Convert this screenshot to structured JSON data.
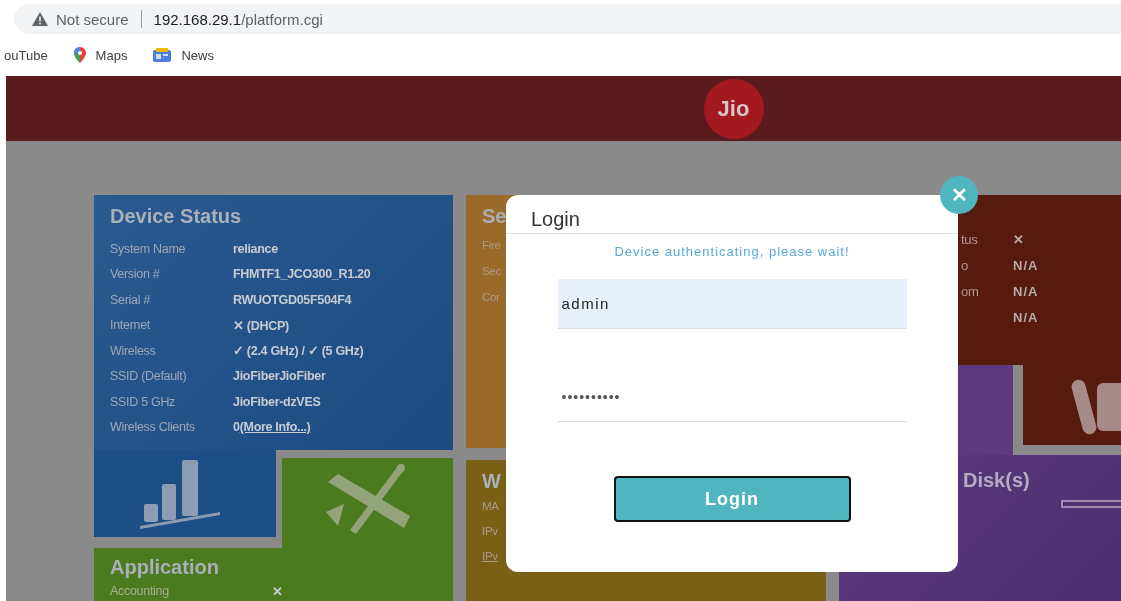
{
  "browser": {
    "security": "Not secure",
    "url_host": "192.168.29.1",
    "url_path": "/platform.cgi",
    "bookmarks": [
      {
        "label": "ouTube",
        "kind": "plain"
      },
      {
        "label": "Maps",
        "kind": "maps"
      },
      {
        "label": "News",
        "kind": "news"
      }
    ]
  },
  "header": {
    "logo": "Jio"
  },
  "device_status": {
    "title": "Device Status",
    "rows": [
      {
        "label": "System Name",
        "value": "reliance"
      },
      {
        "label": "Version #",
        "value": "FHMTF1_JCO300_R1.20"
      },
      {
        "label": "Serial #",
        "value": "RWUOTGD05F504F4"
      },
      {
        "label": "Internet",
        "value": "✕ (DHCP)"
      },
      {
        "label": "Wireless",
        "value": "✓ (2.4 GHz) / ✓ (5 GHz)"
      },
      {
        "label": "SSID (Default)",
        "value": "JioFiberJioFiber"
      },
      {
        "label": "SSID 5 GHz",
        "value": "JioFiber-dzVES"
      },
      {
        "label": "Wireless Clients",
        "value": "0",
        "link": "(More Info...)"
      }
    ]
  },
  "application": {
    "title": "Application",
    "rows": [
      {
        "label": "Accounting",
        "value": "✕"
      }
    ]
  },
  "security_tile": {
    "title": "Se",
    "rows": [
      "Fire",
      "Sec",
      "Cor"
    ]
  },
  "wan_tile": {
    "title": "W",
    "rows": [
      {
        "label": "MA",
        "link": false
      },
      {
        "label": "IPv",
        "link": false
      },
      {
        "label": "IPv",
        "link": true
      }
    ]
  },
  "status_tile": {
    "rows": [
      {
        "label": "tus",
        "value": "✕"
      },
      {
        "label": "o",
        "value": "N/A"
      },
      {
        "label": "om",
        "value": "N/A"
      },
      {
        "label": "",
        "value": "N/A"
      }
    ]
  },
  "disk_tile": {
    "title": "Disk(s)"
  },
  "login_dialog": {
    "title": "Login",
    "message": "Device authenticating, please wait!",
    "username": "admin",
    "password": "••••••••••",
    "button": "Login",
    "close": "✕"
  }
}
